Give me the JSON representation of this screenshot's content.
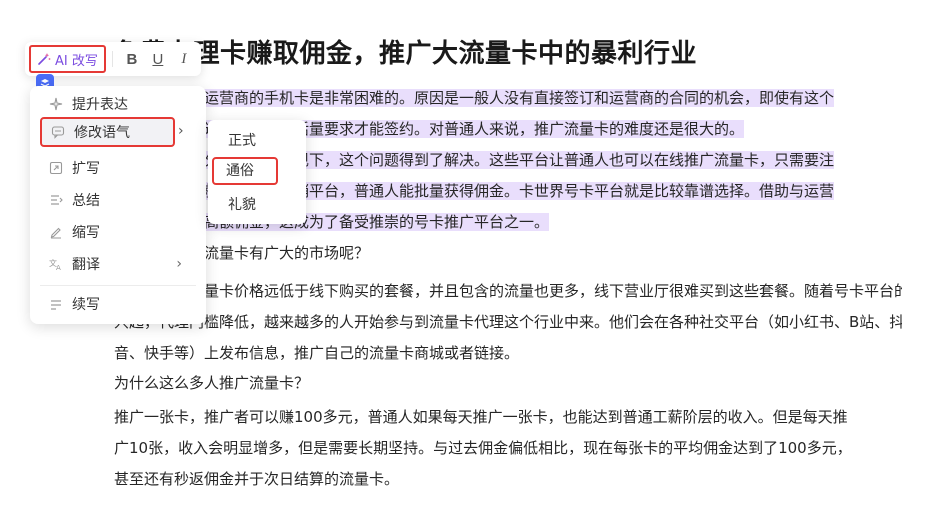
{
  "document": {
    "title": "免费办理卡赚取佣金，推广大流量卡中的暴利行业",
    "paragraphs": [
      {
        "highlight": true,
        "lines": [
          "以往，要推广运营商的手机卡是非常困难的。原因是一般人没有直接签订和运营商的合同的机会，即使有这个",
          "机会，也需要达到一定的激活量要求才能签约。对普通人来说，推广流量卡的难度还是很大的。"
        ]
      },
      {
        "highlight": true,
        "lines": [
          "但是随着号卡分销平台的涌现下，这个问题得到了解决。这些平台让普通人也可以在线推广流量卡，只需要注",
          "册一个账号，就可以通过分销平台，普通人能批量获得佣金。卡世界号卡平台就是比较靠谱选择。借助与运营",
          "商的合作，以高额佣金，这成为了备受推崇的号卡推广平台之一。"
        ]
      },
      {
        "highlight": false,
        "lines": [
          "为什么说推广流量卡有广大的市场呢？"
        ]
      },
      {
        "highlight": false,
        "lines": [
          "网上购买的流量卡价格远低于线下购买的套餐，并且包含的流量也更多，线下营业厅很难买到这些套餐。随着号卡平台的",
          "兴起，代理门槛降低，越来越多的人开始参与到流量卡代理这个行业中来。他们会在各种社交平台（如小红书、B站、抖",
          "音、快手等）上发布信息，推广自己的流量卡商城或者链接。"
        ]
      },
      {
        "highlight": false,
        "lines": [
          "为什么这么多人推广流量卡？"
        ]
      },
      {
        "highlight": false,
        "lines": [
          "推广一张卡，推广者可以赚100多元，普通人如果每天推广一张卡，也能达到普通工薪阶层的收入。但是每天推",
          "广10张，收入会明显增多，但是需要长期坚持。与过去佣金偏低相比，现在每张卡的平均佣金达到了100多元，",
          "甚至还有秒返佣金并于次日结算的流量卡。"
        ]
      }
    ]
  },
  "toolbar": {
    "ai_label": "AI 改写",
    "bold": "B",
    "underline": "U",
    "italic": "I"
  },
  "ai_menu": {
    "items": [
      {
        "label": "提升表达",
        "icon": "sparkle-icon"
      },
      {
        "label": "修改语气",
        "icon": "chat-bubble-icon",
        "has_submenu": true,
        "active": true
      },
      {
        "label": "扩写",
        "icon": "expand-icon"
      },
      {
        "label": "总结",
        "icon": "summary-icon"
      },
      {
        "label": "缩写",
        "icon": "pen-icon"
      },
      {
        "label": "翻译",
        "icon": "translate-icon",
        "has_submenu": true
      },
      {
        "label": "续写",
        "icon": "continue-icon"
      }
    ],
    "arrow": "›"
  },
  "tone_submenu": {
    "items": [
      "正式",
      "通俗",
      "礼貌"
    ],
    "selected": "通俗"
  },
  "colors": {
    "highlight": "#e9defc",
    "accent": "#7b4ce0",
    "annotation_box": "#e53935",
    "badge": "#4a6cf7"
  }
}
